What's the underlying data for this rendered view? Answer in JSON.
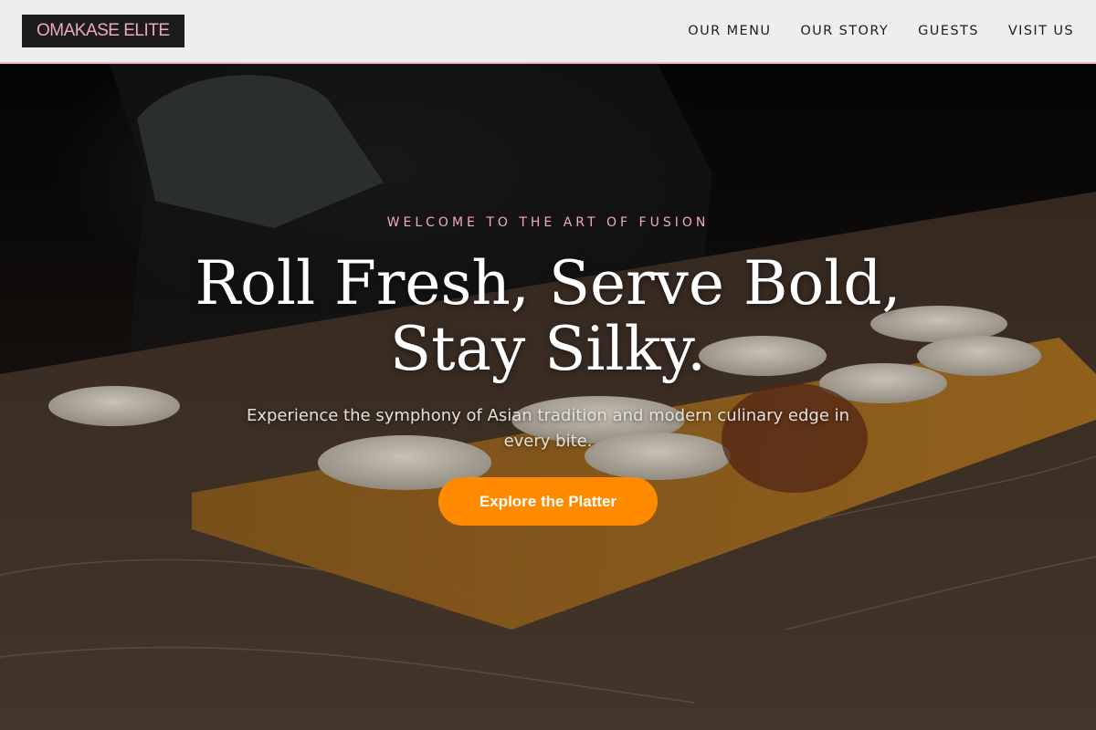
{
  "header": {
    "logo": "OMAKASE ELITE",
    "nav": [
      "OUR MENU",
      "OUR STORY",
      "GUESTS",
      "VISIT US"
    ]
  },
  "hero": {
    "eyebrow": "WELCOME TO THE ART OF FUSION",
    "headline_line1": "Roll Fresh, Serve Bold,",
    "headline_line2": "Stay Silky.",
    "subhead": "Experience the symphony of Asian tradition and modern culinary edge in every bite.",
    "cta_label": "Explore the Platter"
  },
  "colors": {
    "accent_pink": "#f2a9bc",
    "cta_orange": "#ff8a00",
    "header_bg": "#eeeeee",
    "logo_bg": "#1c1c1c"
  }
}
